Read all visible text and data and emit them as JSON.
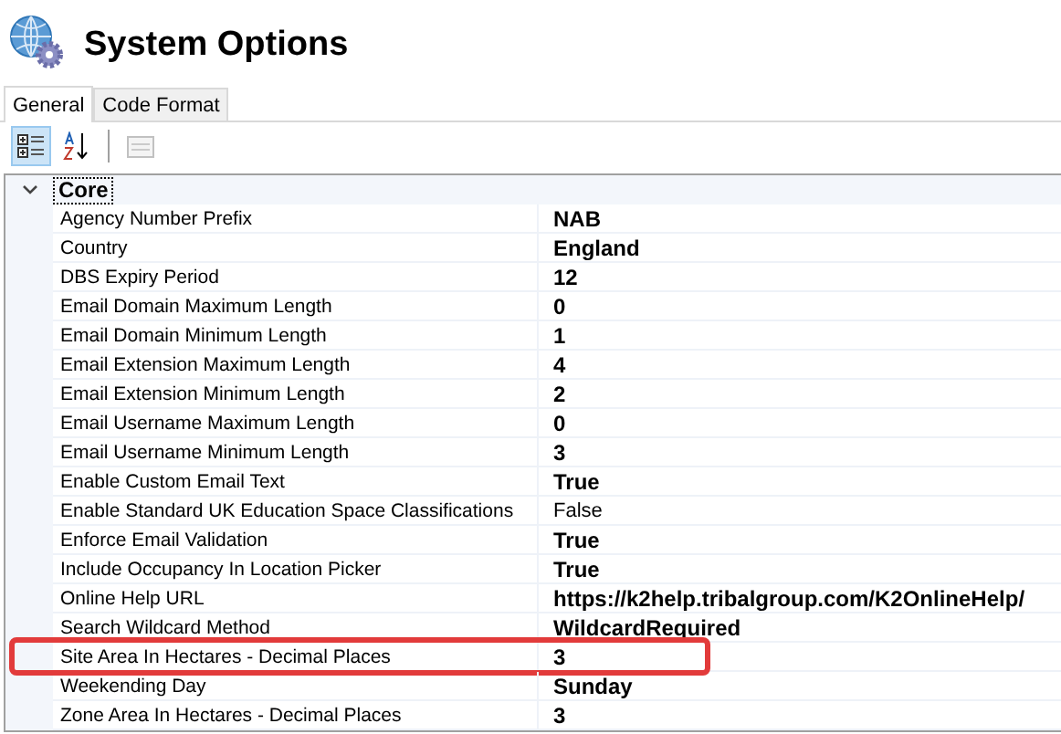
{
  "window": {
    "title": "System Options"
  },
  "tabs": [
    {
      "label": "General",
      "selected": true
    },
    {
      "label": "Code Format",
      "selected": false
    }
  ],
  "toolbar": [
    {
      "kind": "categorized",
      "selected": true
    },
    {
      "kind": "alphabetical",
      "selected": false
    },
    {
      "kind": "pages",
      "selected": false,
      "disabled": true
    }
  ],
  "grid": {
    "categories": [
      {
        "name": "Core",
        "expanded": true,
        "rows": [
          {
            "name": "Agency Number Prefix",
            "value": "NAB",
            "modified": true,
            "highlighted": false
          },
          {
            "name": "Country",
            "value": "England",
            "modified": true,
            "highlighted": false
          },
          {
            "name": "DBS Expiry Period",
            "value": "12",
            "modified": true,
            "highlighted": false
          },
          {
            "name": "Email Domain Maximum Length",
            "value": "0",
            "modified": true,
            "highlighted": false
          },
          {
            "name": "Email Domain Minimum Length",
            "value": "1",
            "modified": true,
            "highlighted": false
          },
          {
            "name": "Email Extension Maximum Length",
            "value": "4",
            "modified": true,
            "highlighted": false
          },
          {
            "name": "Email Extension Minimum Length",
            "value": "2",
            "modified": true,
            "highlighted": false
          },
          {
            "name": "Email Username Maximum Length",
            "value": "0",
            "modified": true,
            "highlighted": false
          },
          {
            "name": "Email Username Minimum Length",
            "value": "3",
            "modified": true,
            "highlighted": false
          },
          {
            "name": "Enable Custom Email Text",
            "value": "True",
            "modified": true,
            "highlighted": false
          },
          {
            "name": "Enable Standard UK Education Space Classifications",
            "value": "False",
            "modified": false,
            "highlighted": false
          },
          {
            "name": "Enforce Email Validation",
            "value": "True",
            "modified": true,
            "highlighted": false
          },
          {
            "name": "Include Occupancy In Location Picker",
            "value": "True",
            "modified": true,
            "highlighted": false
          },
          {
            "name": "Online Help URL",
            "value": "https://k2help.tribalgroup.com/K2OnlineHelp/",
            "modified": true,
            "highlighted": false
          },
          {
            "name": "Search Wildcard Method",
            "value": "WildcardRequired",
            "modified": true,
            "highlighted": false
          },
          {
            "name": "Site Area In Hectares - Decimal Places",
            "value": "3",
            "modified": true,
            "highlighted": true
          },
          {
            "name": "Weekending Day",
            "value": "Sunday",
            "modified": true,
            "highlighted": false
          },
          {
            "name": "Zone Area In Hectares - Decimal Places",
            "value": "3",
            "modified": true,
            "highlighted": false
          }
        ]
      }
    ]
  }
}
